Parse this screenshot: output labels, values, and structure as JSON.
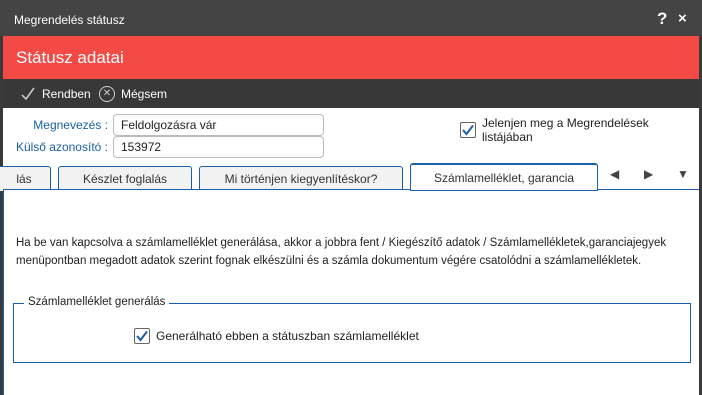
{
  "window": {
    "title": "Megrendelés státusz",
    "help_label": "?",
    "close_label": "×"
  },
  "header": {
    "title": "Státusz adatai"
  },
  "toolbar": {
    "ok_label": "Rendben",
    "cancel_label": "Mégsem"
  },
  "form": {
    "name_label": "Megnevezés :",
    "name_value": "Feldolgozásra vár",
    "external_id_label": "Külső azonosító :",
    "external_id_value": "153972",
    "show_in_list_label": "Jelenjen meg a Megrendelések listájában",
    "show_in_list_checked": true
  },
  "tabs": [
    {
      "label": "lás",
      "active": false
    },
    {
      "label": "Készlet foglalás",
      "active": false
    },
    {
      "label": "Mi történjen kiegyenlítéskor?",
      "active": false
    },
    {
      "label": "Számlamelléklet, garancia",
      "active": true
    }
  ],
  "tab_nav": {
    "prev": "◀",
    "next": "▶",
    "menu": "▼"
  },
  "content": {
    "info_text": "Ha be van kapcsolva a számlamelléklet generálása, akkor a jobbra fent / Kiegészítő adatok / Számlamellékletek,garanciajegyek menüpontban megadott adatok szerint fognak elkészülni és a számla dokumentum végére csatolódni a számlamellékletek.",
    "group_legend": "Számlamelléklet generálás",
    "group_checkbox_label": "Generálható ebben a státuszban számlamelléklet",
    "group_checkbox_checked": true
  },
  "colors": {
    "accent_red": "#f44a45",
    "toolbar_dark": "#383838",
    "link_blue": "#1a5fa8"
  }
}
